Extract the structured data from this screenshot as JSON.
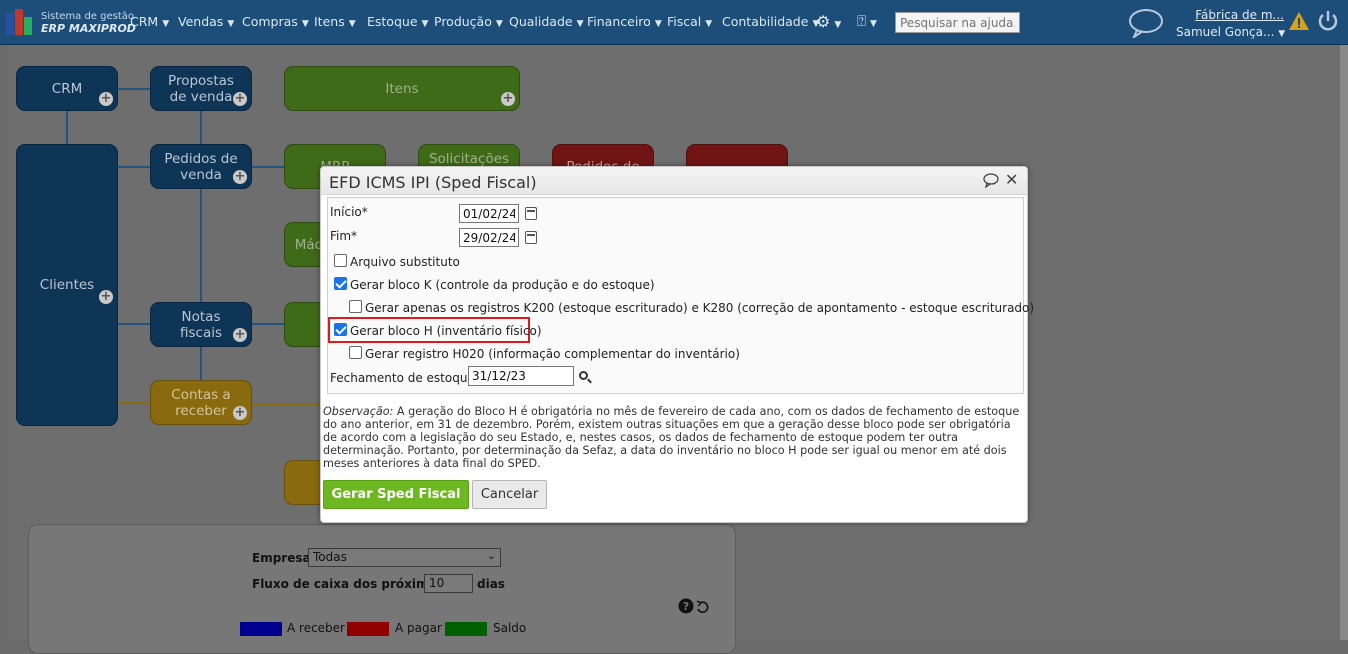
{
  "brand": {
    "line1": "Sistema de gestão",
    "line2": "ERP MAXIPROD"
  },
  "nav": {
    "items": [
      "CRM",
      "Vendas",
      "Compras",
      "Itens",
      "Estoque",
      "Produção",
      "Qualidade",
      "Financeiro",
      "Fiscal",
      "Contabilidade"
    ],
    "search_placeholder": "Pesquisar na ajuda...",
    "company": "Fábrica de m...",
    "user": "Samuel Gonça..."
  },
  "flow": {
    "crm": "CRM",
    "propostas": "Propostas de venda",
    "itens": "Itens",
    "clientes": "Clientes",
    "pedidos_venda": "Pedidos de venda",
    "mrp": "MRP",
    "solicitacoes": "Solicitações de",
    "pedidos_de": "Pedidos de",
    "maquinas": "Máq",
    "notas_fiscais": "Notas fiscais",
    "contas_receber": "Contas a receber"
  },
  "panel": {
    "empresa_label": "Empresa",
    "empresa_value": "Todas",
    "fluxo_label": "Fluxo de caixa dos próximos",
    "fluxo_value": "10",
    "dias_label": "dias",
    "legend": [
      {
        "label": "A receber",
        "color": "#00008f"
      },
      {
        "label": "A pagar",
        "color": "#8f0000"
      },
      {
        "label": "Saldo",
        "color": "#006000"
      }
    ]
  },
  "modal": {
    "title": "EFD ICMS IPI (Sped Fiscal)",
    "inicio_label": "Início*",
    "inicio_value": "01/02/24",
    "fim_label": "Fim*",
    "fim_value": "29/02/24",
    "arquivo_substituto": "Arquivo substituto",
    "gerar_bloco_k": "Gerar bloco K (controle da produção e do estoque)",
    "gerar_k200": "Gerar apenas os registros K200 (estoque escriturado) e K280 (correção de apontamento - estoque escriturado)",
    "gerar_bloco_h": "Gerar bloco H (inventário físico)",
    "gerar_h020": "Gerar registro H020 (informação complementar do inventário)",
    "fechamento_label": "Fechamento de estoque*",
    "fechamento_value": "31/12/23",
    "obs_label": "Observação:",
    "obs_text": " A geração do Bloco H é obrigatória no mês de fevereiro de cada ano, com os dados de fechamento de estoque do ano anterior, em 31 de dezembro. Porém, existem outras situações em que a geração desse bloco pode ser obrigatória de acordo com a legislação do seu Estado, e, nestes casos, os dados de fechamento de estoque podem ter outra determinação. Portanto, por determinação da Sefaz, a data do inventário no bloco H pode ser igual ou menor em até dois meses anteriores à data final do SPED.",
    "submit": "Gerar Sped Fiscal",
    "cancel": "Cancelar",
    "checks": {
      "arquivo_substituto": false,
      "gerar_bloco_k": true,
      "gerar_k200": false,
      "gerar_bloco_h": true,
      "gerar_h020": false
    }
  }
}
